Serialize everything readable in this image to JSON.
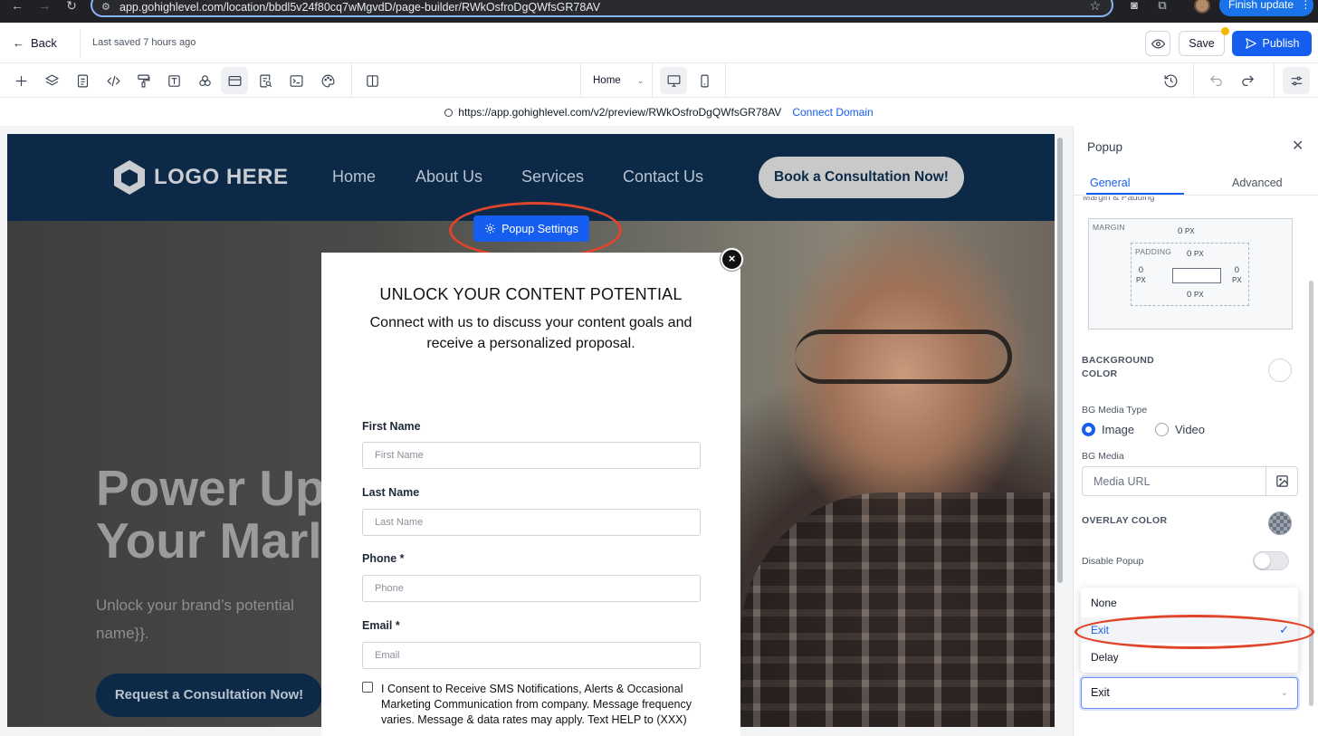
{
  "browser": {
    "url": "app.gohighlevel.com/location/bbdl5v24f80cq7wMgvdD/page-builder/RWkOsfroDgQWfsGR78AV",
    "finish_update_label": "Finish update",
    "icons": [
      "back-arrow-icon",
      "forward-arrow-icon",
      "reload-icon",
      "tune-icon",
      "star-icon",
      "camera-icon",
      "extensions-icon",
      "kebab-icon"
    ]
  },
  "header": {
    "back_label": "Back",
    "last_saved": "Last saved 7 hours ago",
    "save_label": "Save",
    "publish_label": "Publish",
    "icons": [
      "eye-icon",
      "send-icon"
    ]
  },
  "toolbar": {
    "tools": [
      "add",
      "layers",
      "pages",
      "code",
      "paint",
      "text",
      "elements",
      "sections",
      "search-doc",
      "terminal",
      "palette",
      "columns"
    ],
    "page_select": "Home",
    "icons": [
      "desktop-icon",
      "mobile-icon",
      "history-icon",
      "undo-icon",
      "redo-icon",
      "settings-sliders-icon"
    ]
  },
  "preview": {
    "url": "https://app.gohighlevel.com/v2/preview/RWkOsfroDgQWfsGR78AV",
    "connect_domain": "Connect Domain"
  },
  "site": {
    "logo_text": "LOGO HERE",
    "nav": [
      "Home",
      "About Us",
      "Services",
      "Contact Us"
    ],
    "cta": "Book a Consultation Now!",
    "hero_title_line1": "Power Up",
    "hero_title_line2": "Your Marl",
    "hero_sub_line1": "Unlock your brand’s potential",
    "hero_sub_line2": "name}}.",
    "hero_button": "Request a Consultation Now!",
    "colors": {
      "navy": "#0c2a47",
      "accent": "#155eef"
    }
  },
  "popup_settings_label": "Popup Settings",
  "popup": {
    "heading": "UNLOCK YOUR CONTENT POTENTIAL",
    "description": "Connect with us to discuss your content goals and receive a personalized proposal.",
    "close_symbol": "×",
    "fields": [
      {
        "label": "First Name",
        "placeholder": "First Name"
      },
      {
        "label": "Last Name",
        "placeholder": "Last Name"
      },
      {
        "label": "Phone *",
        "placeholder": "Phone"
      },
      {
        "label": "Email *",
        "placeholder": "Email"
      }
    ],
    "consent": "I Consent to Receive SMS Notifications, Alerts & Occasional Marketing Communication from company. Message frequency varies. Message & data rates may apply. Text HELP to (XXX)"
  },
  "panel": {
    "title": "Popup",
    "tabs": [
      "General",
      "Advanced"
    ],
    "active_tab": "General",
    "margin_padding_label": "Margin & Padding",
    "margin_label": "MARGIN",
    "padding_label": "PADDING",
    "margin_top": "0",
    "padding_top": "0",
    "padding_left": "0",
    "padding_right": "0",
    "padding_bottom": "0",
    "unit": "PX",
    "background_color_label_1": "BACKGROUND",
    "background_color_label_2": "COLOR",
    "bg_media_type_label": "BG Media Type",
    "bg_media_type_options": [
      "Image",
      "Video"
    ],
    "bg_media_type_selected": "Image",
    "bg_media_label": "BG Media",
    "media_placeholder": "Media URL",
    "overlay_color_label": "OVERLAY COLOR",
    "disable_popup_label": "Disable Popup",
    "disable_popup_on": false,
    "trigger_options": [
      "None",
      "Exit",
      "Delay"
    ],
    "trigger_selected": "Exit"
  }
}
